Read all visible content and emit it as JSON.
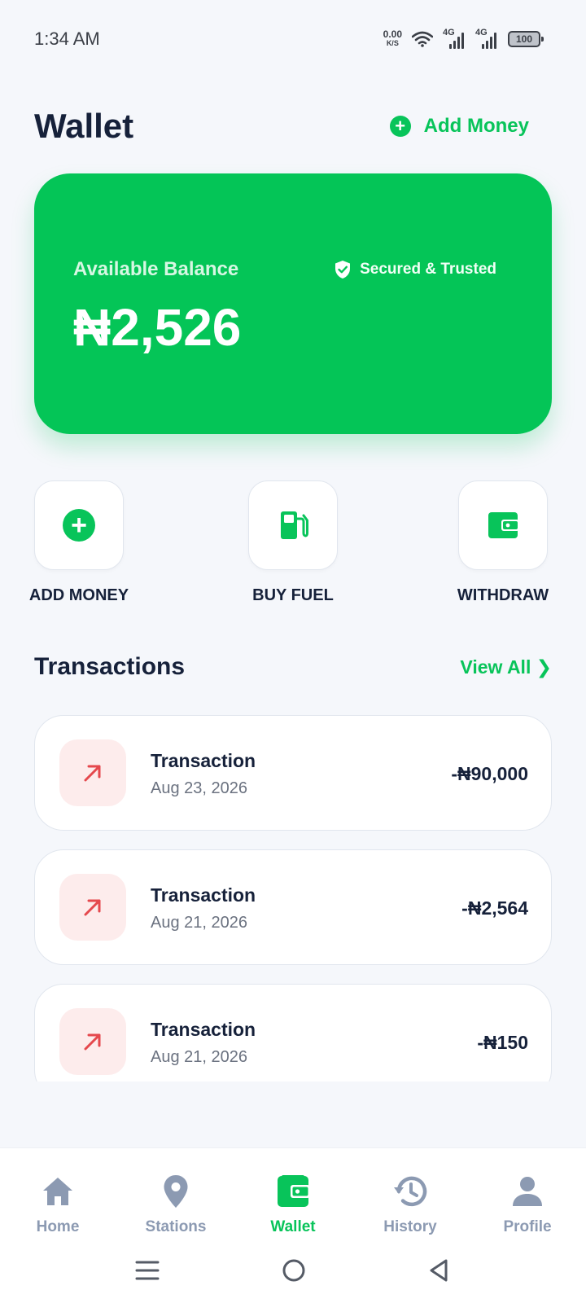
{
  "status_bar": {
    "time": "1:34 AM",
    "net_speed": "0.00",
    "net_unit": "K/S",
    "signal_label_1": "4G",
    "signal_label_2": "4G",
    "battery": "100"
  },
  "header": {
    "title": "Wallet",
    "add_money_label": "Add Money"
  },
  "balance_card": {
    "label": "Available Balance",
    "badge": "Secured & Trusted",
    "amount": "₦2,526",
    "color": "#04c557"
  },
  "quick_actions": [
    {
      "label": "ADD MONEY",
      "icon": "plus-circle-icon"
    },
    {
      "label": "BUY FUEL",
      "icon": "fuel-pump-icon"
    },
    {
      "label": "WITHDRAW",
      "icon": "wallet-icon"
    }
  ],
  "transactions": {
    "title": "Transactions",
    "view_all": "View All ❯",
    "items": [
      {
        "name": "Transaction",
        "date": "Aug 23, 2026",
        "amount": "-₦90,000",
        "icon": "arrow-up-right-icon"
      },
      {
        "name": "Transaction",
        "date": "Aug 21, 2026",
        "amount": "-₦2,564",
        "icon": "arrow-up-right-icon"
      },
      {
        "name": "Transaction",
        "date": "Aug 21, 2026",
        "amount": "-₦150",
        "icon": "arrow-up-right-icon"
      }
    ]
  },
  "bottom_nav": {
    "active": "Wallet",
    "items": [
      {
        "label": "Home",
        "icon": "home-icon"
      },
      {
        "label": "Stations",
        "icon": "location-pin-icon"
      },
      {
        "label": "Wallet",
        "icon": "wallet-icon"
      },
      {
        "label": "History",
        "icon": "history-icon"
      },
      {
        "label": "Profile",
        "icon": "user-icon"
      }
    ]
  },
  "colors": {
    "accent": "#08c45a",
    "debit_icon_bg": "#fdecec",
    "debit_icon": "#e5484d",
    "nav_inactive": "#8c9ab2"
  }
}
